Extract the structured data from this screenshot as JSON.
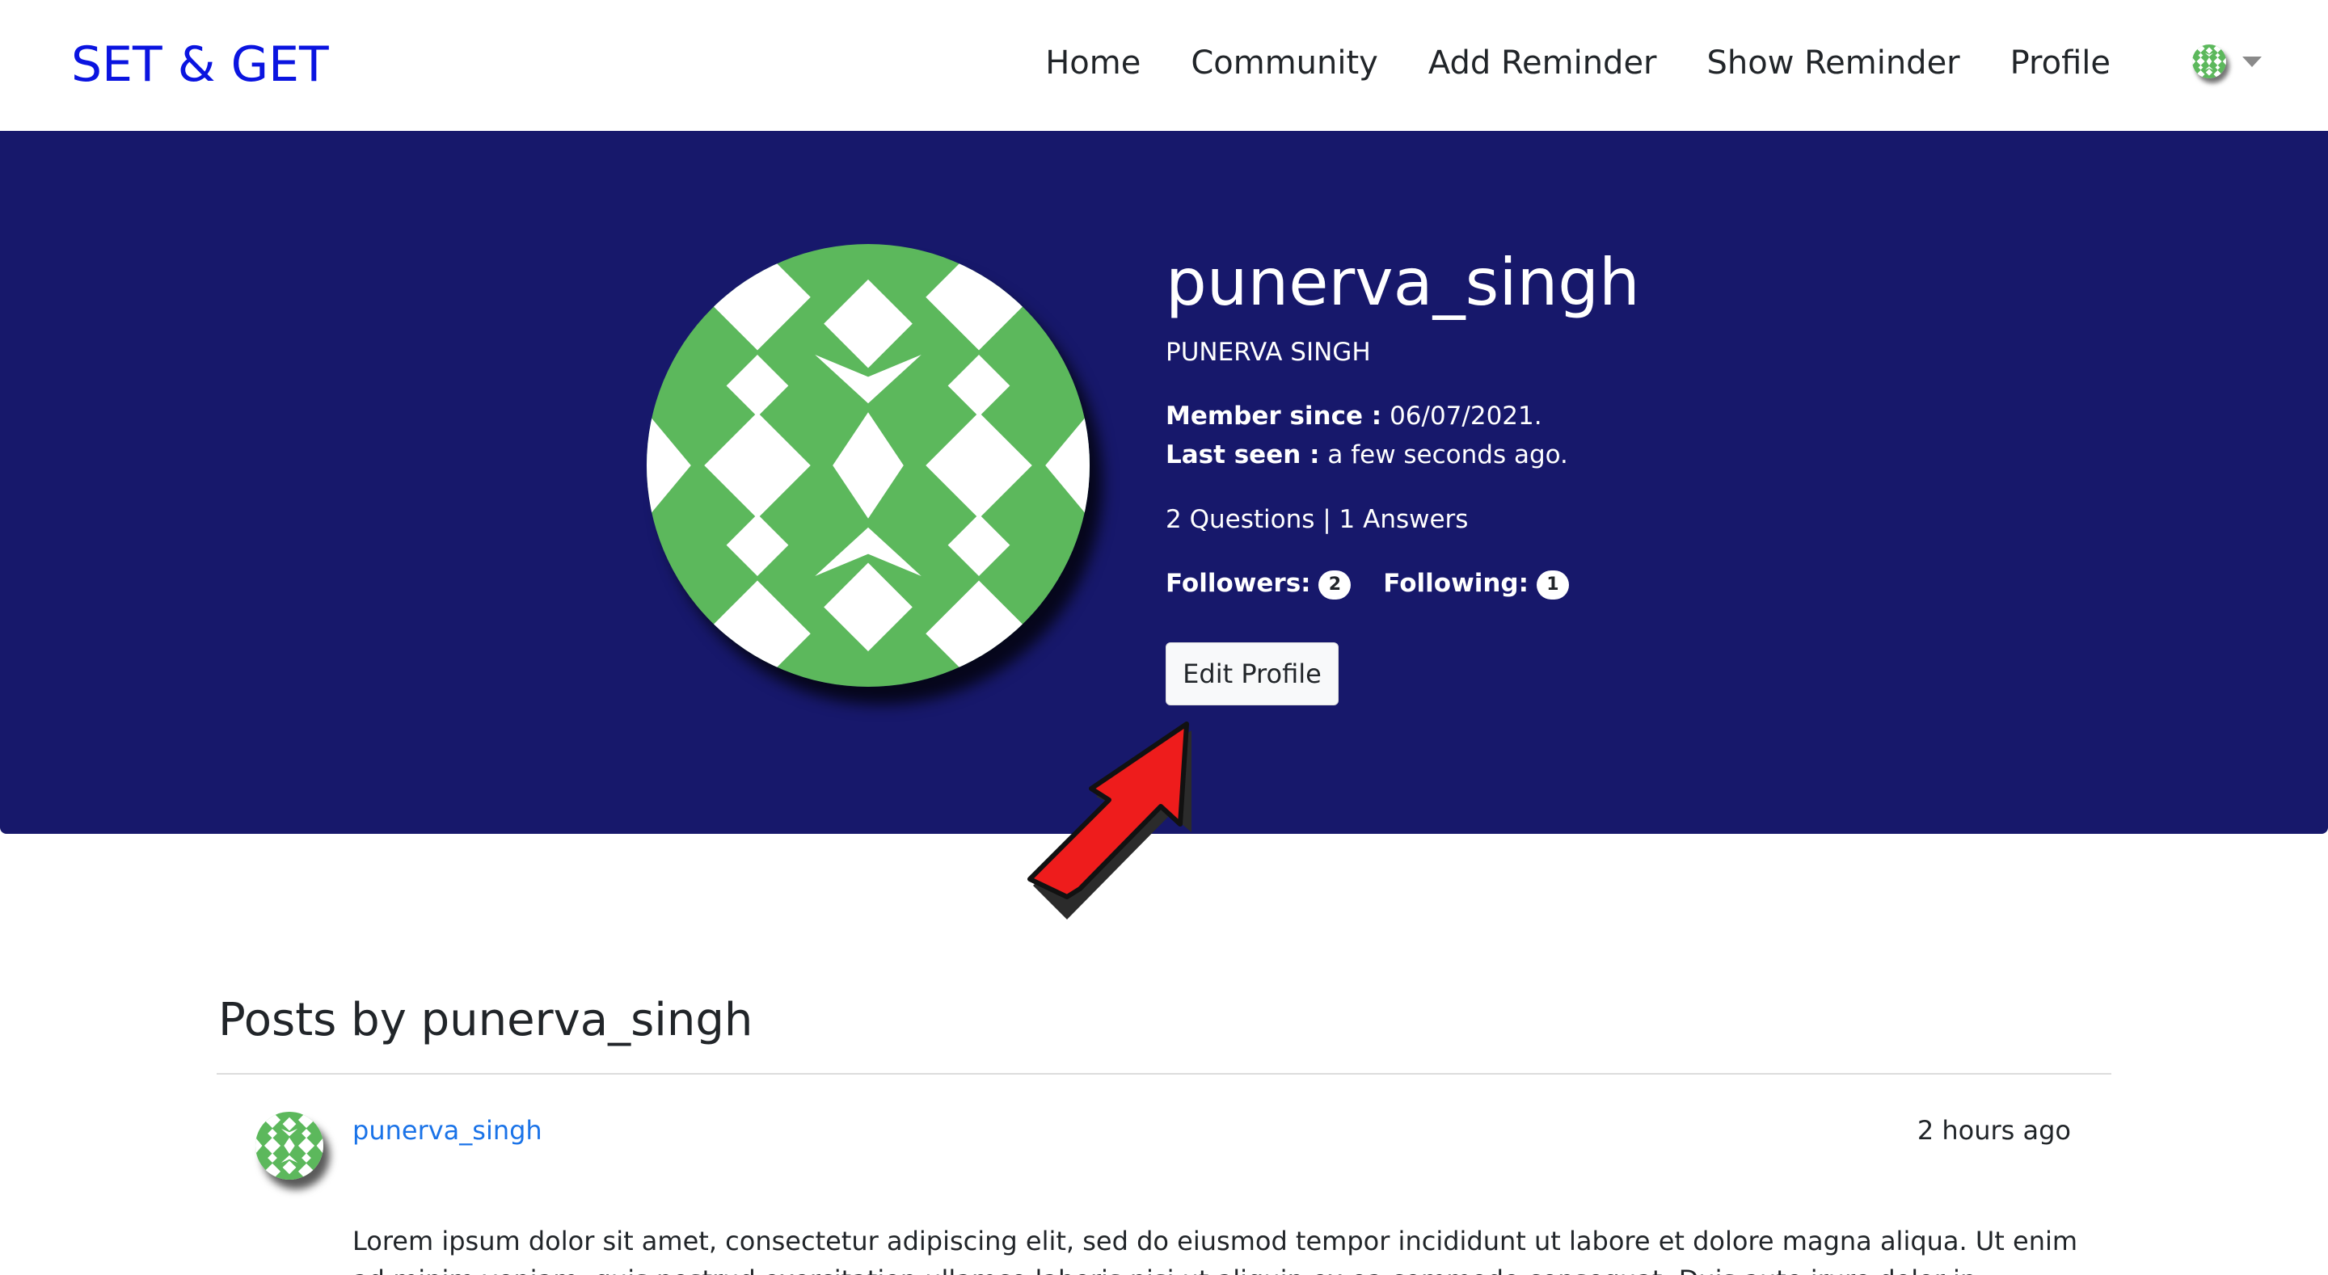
{
  "navbar": {
    "brand": "SET & GET",
    "links": [
      "Home",
      "Community",
      "Add Reminder",
      "Show Reminder",
      "Profile"
    ],
    "avatar_icon": "user-avatar-icon"
  },
  "profile": {
    "username": "punerva_singh",
    "full_name": "PUNERVA SINGH",
    "member_since_label": "Member since :",
    "member_since_value": " 06/07/2021.",
    "last_seen_label": "Last seen :",
    "last_seen_value": " a few seconds ago.",
    "questions_answers": "2 Questions | 1 Answers",
    "followers_label": "Followers:",
    "followers_count": "2",
    "following_label": "Following:",
    "following_count": "1",
    "edit_button": "Edit Profile"
  },
  "posts": {
    "title": "Posts by punerva_singh",
    "items": [
      {
        "author": "punerva_singh",
        "time": "2 hours ago",
        "body": "Lorem ipsum dolor sit amet, consectetur adipiscing elit, sed do eiusmod tempor incididunt ut labore et dolore magna aliqua. Ut enim ad minim veniam, quis nostrud exercitation ullamco laboris nisi ut aliquip ex ea commodo consequat. Duis aute irure dolor in reprehenderit in voluptate velit"
      }
    ]
  },
  "colors": {
    "brand": "#0a14e0",
    "hero_bg": "#17186b",
    "avatar_green": "#5cb85c",
    "link_blue": "#1a73e8",
    "arrow_red": "#ee1c1c"
  }
}
